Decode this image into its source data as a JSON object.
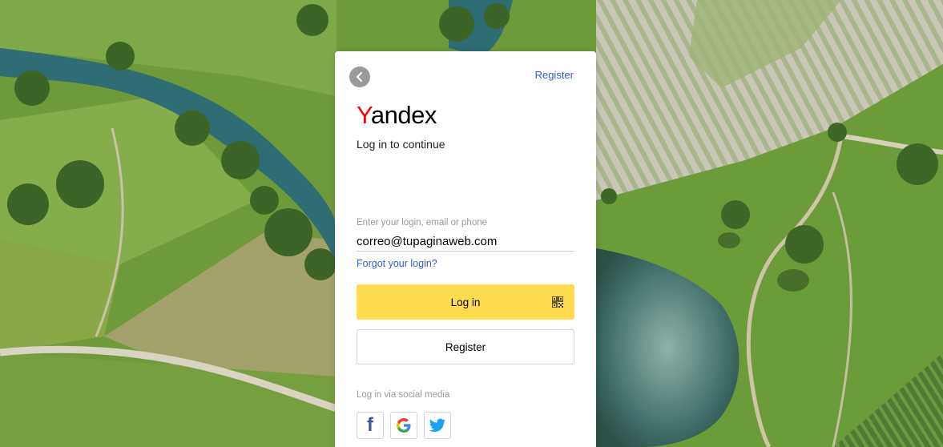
{
  "header": {
    "register_link": "Register"
  },
  "brand": {
    "logo_first_letter": "Y",
    "logo_rest": "andex",
    "logo_color_first": "#ff0000",
    "logo_color_rest": "#000000"
  },
  "form": {
    "subtitle": "Log in to continue",
    "login_label": "Enter your login, email or phone",
    "login_value": "correo@tupaginaweb.com",
    "forgot_link": "Forgot your login?",
    "login_button": "Log in",
    "register_button": "Register"
  },
  "social": {
    "label": "Log in via social media",
    "providers": [
      {
        "name": "facebook",
        "icon": "facebook-icon",
        "glyph": "f"
      },
      {
        "name": "google",
        "icon": "google-icon",
        "glyph": "G"
      },
      {
        "name": "twitter",
        "icon": "twitter-icon"
      }
    ]
  },
  "colors": {
    "accent_yellow": "#ffdb4d",
    "link_blue": "#2f5fd0"
  }
}
